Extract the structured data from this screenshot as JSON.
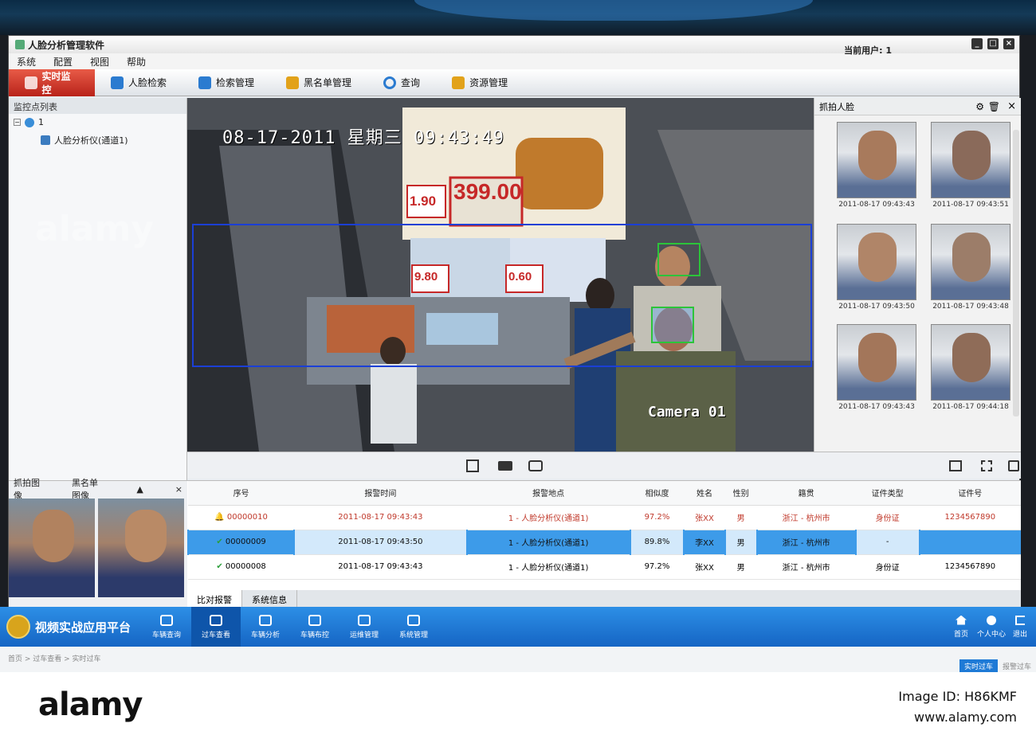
{
  "app": {
    "title": "人脸分析管理软件",
    "current_user_label": "当前用户: 1",
    "window_buttons": [
      "_",
      "□",
      "×"
    ]
  },
  "menu": [
    "系统",
    "配置",
    "视图",
    "帮助"
  ],
  "toolbar": [
    {
      "label": "实时监控",
      "active": true
    },
    {
      "label": "人脸检索"
    },
    {
      "label": "检索管理"
    },
    {
      "label": "黑名单管理"
    },
    {
      "label": "查询"
    },
    {
      "label": "资源管理"
    }
  ],
  "left_panel": {
    "title": "监控点列表",
    "tree": [
      {
        "label": "1"
      },
      {
        "label": "人脸分析仪(通道1)"
      }
    ]
  },
  "video": {
    "osd_datetime": "08-17-2011 星期三 09:43:49",
    "camera_label": "Camera 01",
    "ad_price_main": "399.00",
    "ad_price_left": "1.90",
    "ad_price_2": "9.80",
    "ad_price_3": "0.60"
  },
  "right_panel": {
    "title": "抓拍人脸",
    "faces": [
      {
        "time": "2011-08-17 09:43:43",
        "color": "#a87a5c"
      },
      {
        "time": "2011-08-17 09:43:51",
        "color": "#8a6a5a"
      },
      {
        "time": "2011-08-17 09:43:50",
        "color": "#b08568"
      },
      {
        "time": "2011-08-17 09:43:48",
        "color": "#9c7d69"
      },
      {
        "time": "2011-08-17 09:43:43",
        "color": "#a3765a"
      },
      {
        "time": "2011-08-17 09:44:18",
        "color": "#8f6c58"
      }
    ]
  },
  "snap_panel": {
    "left_label": "抓拍图像",
    "right_label": "黑名单图像"
  },
  "alarm_table": {
    "headers": [
      "序号",
      "报警时间",
      "报警地点",
      "相似度",
      "姓名",
      "性别",
      "籍贯",
      "证件类型",
      "证件号"
    ],
    "rows": [
      {
        "id": "00000010",
        "time": "2011-08-17 09:43:43",
        "place": "1 - 人脸分析仪(通道1)",
        "sim": "97.2%",
        "name": "张XX",
        "sex": "男",
        "origin": "浙江 - 杭州市",
        "id_type": "身份证",
        "id_no": "1234567890",
        "state": "alert"
      },
      {
        "id": "00000009",
        "time": "2011-08-17 09:43:50",
        "place": "1 - 人脸分析仪(通道1)",
        "sim": "89.8%",
        "name": "李XX",
        "sex": "男",
        "origin": "浙江 - 杭州市",
        "id_type": "-",
        "id_no": "",
        "state": "selected"
      },
      {
        "id": "00000008",
        "time": "2011-08-17 09:43:43",
        "place": "1 - 人脸分析仪(通道1)",
        "sim": "97.2%",
        "name": "张XX",
        "sex": "男",
        "origin": "浙江 - 杭州市",
        "id_type": "身份证",
        "id_no": "1234567890",
        "state": "normal"
      }
    ]
  },
  "bottom_tabs": [
    "比对报警",
    "系统信息"
  ],
  "platform": {
    "title": "视频实战应用平台",
    "nav": [
      {
        "label": "车辆查询",
        "icon": "search-icon"
      },
      {
        "label": "过车查看",
        "icon": "car-icon",
        "active": true
      },
      {
        "label": "车辆分析",
        "icon": "chart-icon"
      },
      {
        "label": "车辆布控",
        "icon": "map-pin-icon"
      },
      {
        "label": "运维管理",
        "icon": "calendar-icon"
      },
      {
        "label": "系统管理",
        "icon": "gear-icon"
      }
    ],
    "right": [
      "首页",
      "个人中心",
      "退出"
    ],
    "breadcrumb": "首页 > 过车查看 > 实时过车",
    "sub_tabs": [
      "实时过车",
      "报警过车"
    ]
  },
  "footer": {
    "brand": "alamy",
    "image_id": "Image ID: H86KMF",
    "site": "www.alamy.com"
  }
}
